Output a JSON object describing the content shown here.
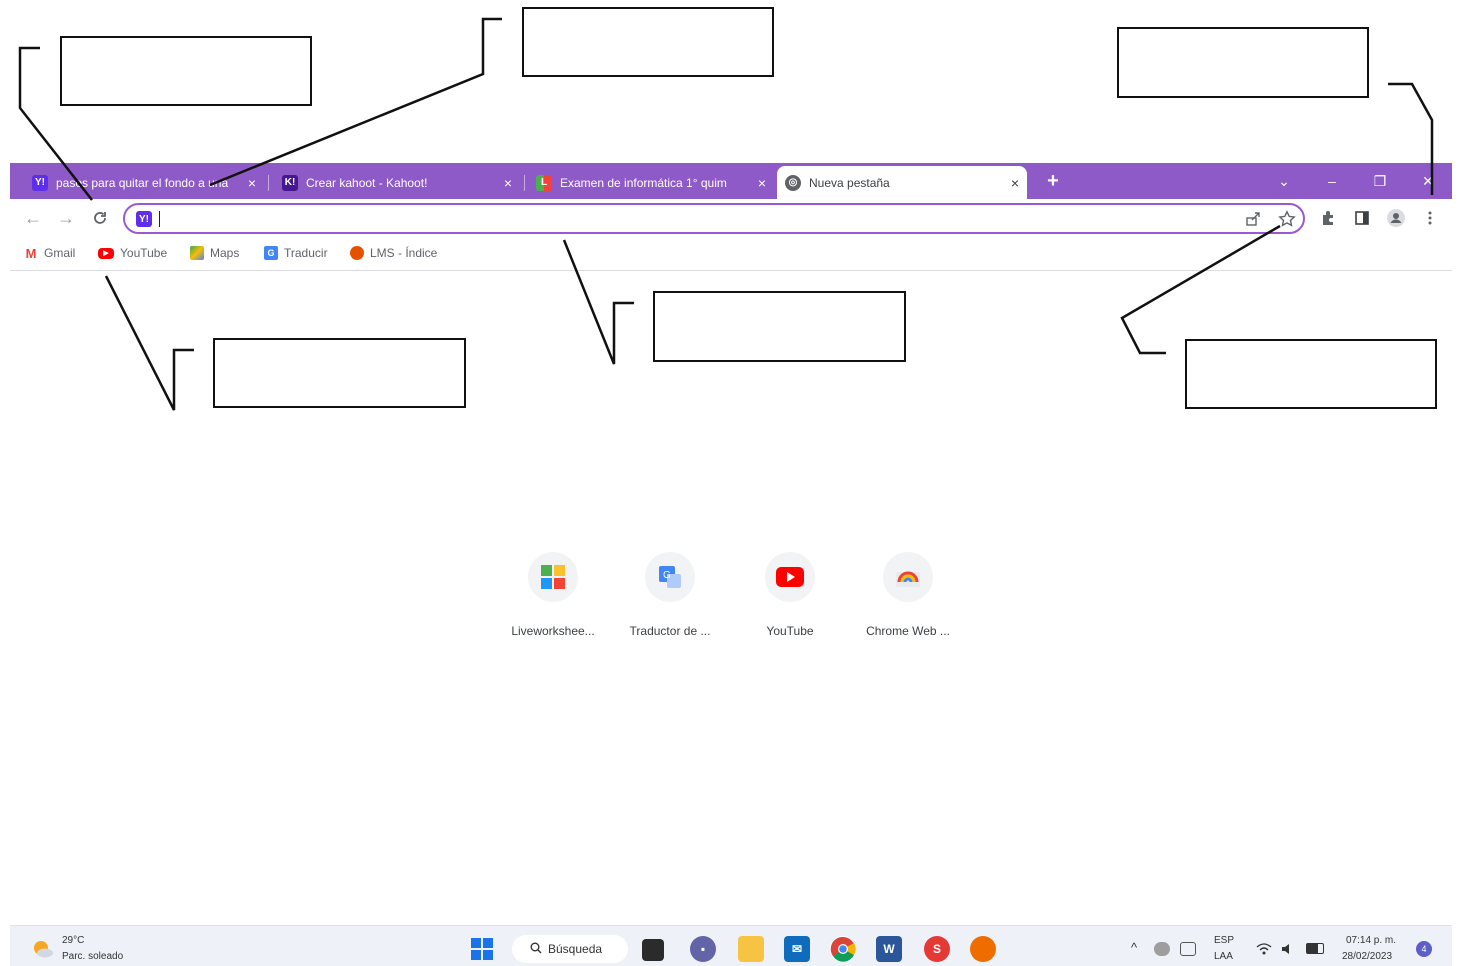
{
  "browser": {
    "tabs": [
      {
        "title": "pasos para quitar el fondo a una",
        "favicon": "yahoo-icon",
        "active": false
      },
      {
        "title": "Crear kahoot - Kahoot!",
        "favicon": "kahoot-icon",
        "active": false
      },
      {
        "title": "Examen de informática 1° quim",
        "favicon": "liveworksheets-icon",
        "active": false
      },
      {
        "title": "Nueva pestaña",
        "favicon": "globe-icon",
        "active": true
      }
    ],
    "new_tab_symbol": "+",
    "close_symbol": "×",
    "tab_search_symbol": "⌄",
    "window_controls": {
      "minimize": "–",
      "restore": "❐",
      "close": "✕"
    },
    "nav": {
      "back": "←",
      "forward": "→",
      "reload": "C"
    },
    "omnibox": {
      "value": "",
      "favicon": "yahoo-icon"
    },
    "bookmarks": [
      {
        "label": "Gmail",
        "icon": "gmail-icon",
        "color": "#ea4335"
      },
      {
        "label": "YouTube",
        "icon": "youtube-icon",
        "color": "#ff0000"
      },
      {
        "label": "Maps",
        "icon": "maps-icon",
        "color": "#34a853"
      },
      {
        "label": "Traducir",
        "icon": "translate-icon",
        "color": "#4285f4"
      },
      {
        "label": "LMS - Índice",
        "icon": "lms-icon",
        "color": "#e65100"
      }
    ]
  },
  "shortcuts": [
    {
      "label": "Liveworkshee...",
      "icon": "liveworksheets-icon"
    },
    {
      "label": "Traductor de ...",
      "icon": "translate-icon"
    },
    {
      "label": "YouTube",
      "icon": "youtube-icon"
    },
    {
      "label": "Chrome Web ...",
      "icon": "chrome-web-store-icon"
    }
  ],
  "taskbar": {
    "weather_temp": "29°C",
    "weather_desc": "Parc. soleado",
    "search_label": "Búsqueda",
    "language": "ESP",
    "layout": "LAA",
    "time": "07:14 p. m.",
    "date": "28/02/2023",
    "notification_count": "4",
    "tray_arrow": "^"
  },
  "colors": {
    "tab_strip": "#8e5ac8",
    "omnibox_border": "#9b59d0"
  }
}
